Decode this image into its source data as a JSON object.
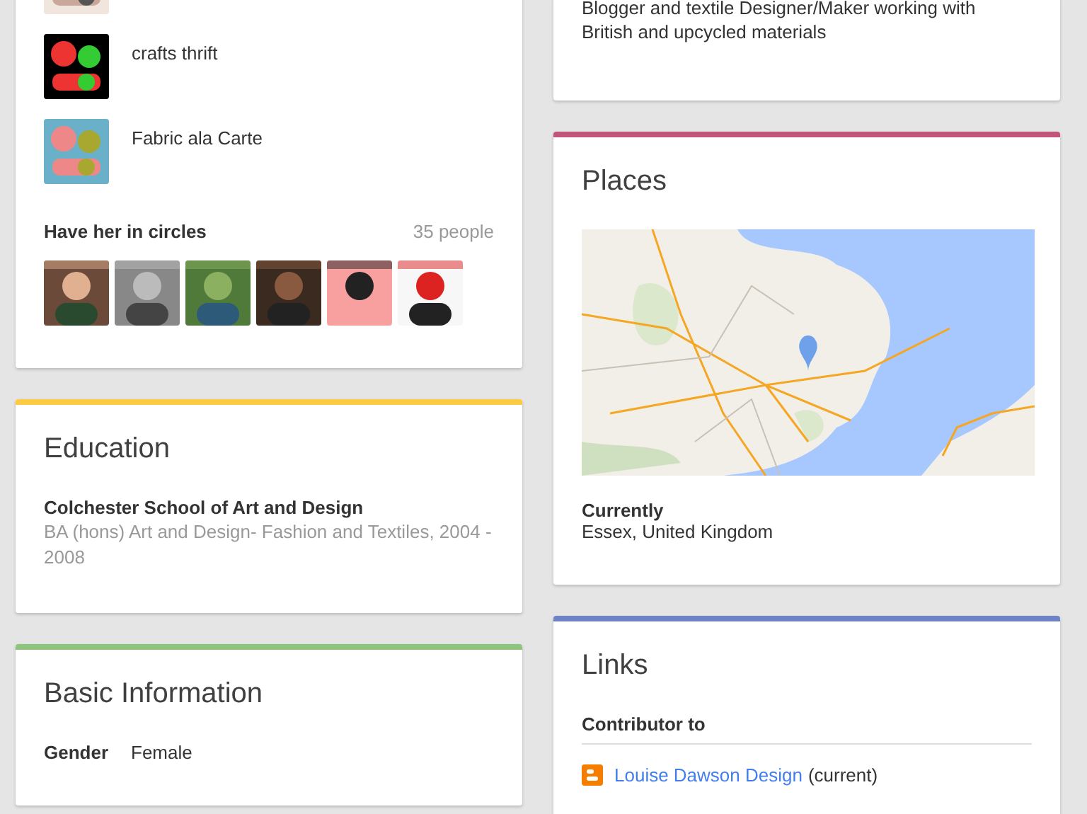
{
  "left_column": [
    {
      "kind": "pages",
      "items": [
        {
          "kind": "picture"
        },
        {
          "kind": "picture",
          "label": "crafts thrift"
        },
        {
          "kind": "picture",
          "label": "Fabric ala Carte"
        }
      ],
      "circles": {
        "title": "Have her in circles",
        "count": "35 people",
        "people": [
          {
            "kind": "picture"
          },
          {
            "kind": "picture"
          },
          {
            "kind": "picture"
          },
          {
            "kind": "picture"
          },
          {
            "kind": "picture"
          },
          {
            "kind": "picture"
          }
        ]
      }
    },
    {
      "kind": "education",
      "title": "Education",
      "color": "#fbcb43",
      "school": "Colchester School of Art and Design",
      "detail": "BA (hons) Art and Design- Fashion and Textiles, 2004 - 2008"
    },
    {
      "kind": "basic",
      "title": "Basic Information",
      "color": "#8cc57b",
      "fields": [
        {
          "label": "Gender",
          "value": "Female"
        }
      ]
    }
  ],
  "right_column": [
    {
      "kind": "intro",
      "text": "Blogger and textile Designer/Maker working with British and upcycled materials"
    },
    {
      "kind": "places",
      "title": "Places",
      "color": "#c1567a",
      "map": {
        "kind": "picture"
      },
      "label": "Currently",
      "value": "Essex, United Kingdom"
    },
    {
      "kind": "links",
      "title": "Links",
      "color": "#6e83c4",
      "section": "Contributor to",
      "links": [
        {
          "text": "Louise Dawson Design",
          "note": "(current)"
        }
      ]
    }
  ]
}
